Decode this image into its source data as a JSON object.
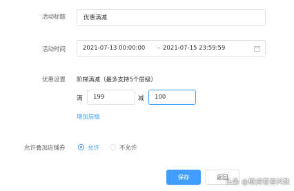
{
  "form": {
    "title_label": "活动标题",
    "title_value": "优惠满减",
    "time_label": "活动时间",
    "time_start": "2021-07-13 00:00:00",
    "time_separator": "–",
    "time_end": "2021-07-15 23:59:59",
    "time_icon": "calendar-icon",
    "discount_label": "优惠设置",
    "discount_hint": "阶梯满减（最多支持5个层级）",
    "tier_full_label": "满",
    "tier_full_value": "199",
    "tier_reduce_label": "减",
    "tier_reduce_value": "100",
    "add_tier_link": "增加层级",
    "stack_label": "允许叠加店铺券",
    "stack_options": [
      {
        "label": "允许",
        "checked": true
      },
      {
        "label": "不允许",
        "checked": false
      }
    ]
  },
  "footer": {
    "save_label": "保存",
    "back_label": "返回"
  },
  "watermark": "头条 @壁虎看看抖数",
  "colors": {
    "accent": "#409eff",
    "border": "#dcdfe6",
    "label": "#606266"
  }
}
